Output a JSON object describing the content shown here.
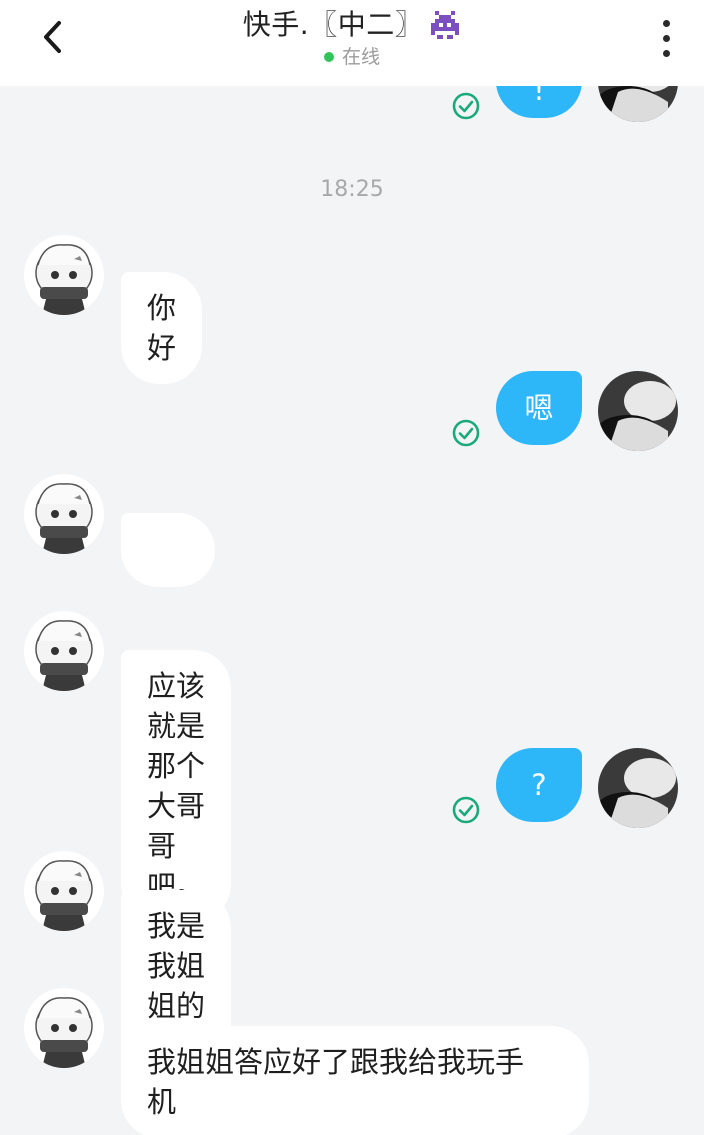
{
  "header": {
    "title": "快手.〖中二〗",
    "title_icon": "alien-monster-icon",
    "status_text": "在线",
    "status_color": "#2fc55a"
  },
  "colors": {
    "outgoing_bubble": "#2db6f8",
    "incoming_bubble": "#ffffff",
    "background": "#f3f4f6",
    "read_check": "#1aaa7a"
  },
  "timestamp": "18:25",
  "messages": [
    {
      "direction": "out",
      "text": "!",
      "read": true
    },
    {
      "direction": "in",
      "text": "你好"
    },
    {
      "direction": "out",
      "text": "嗯",
      "read": true
    },
    {
      "direction": "in",
      "text": "",
      "emoji": "smirk-emoji-icon"
    },
    {
      "direction": "in",
      "text": "应该就是那个大哥哥吧。"
    },
    {
      "direction": "out",
      "text": "?",
      "read": true
    },
    {
      "direction": "in",
      "text": "我是我姐姐的妹妹。"
    },
    {
      "direction": "in",
      "text": "我姐姐答应好了跟我给我玩手\n机"
    }
  ]
}
